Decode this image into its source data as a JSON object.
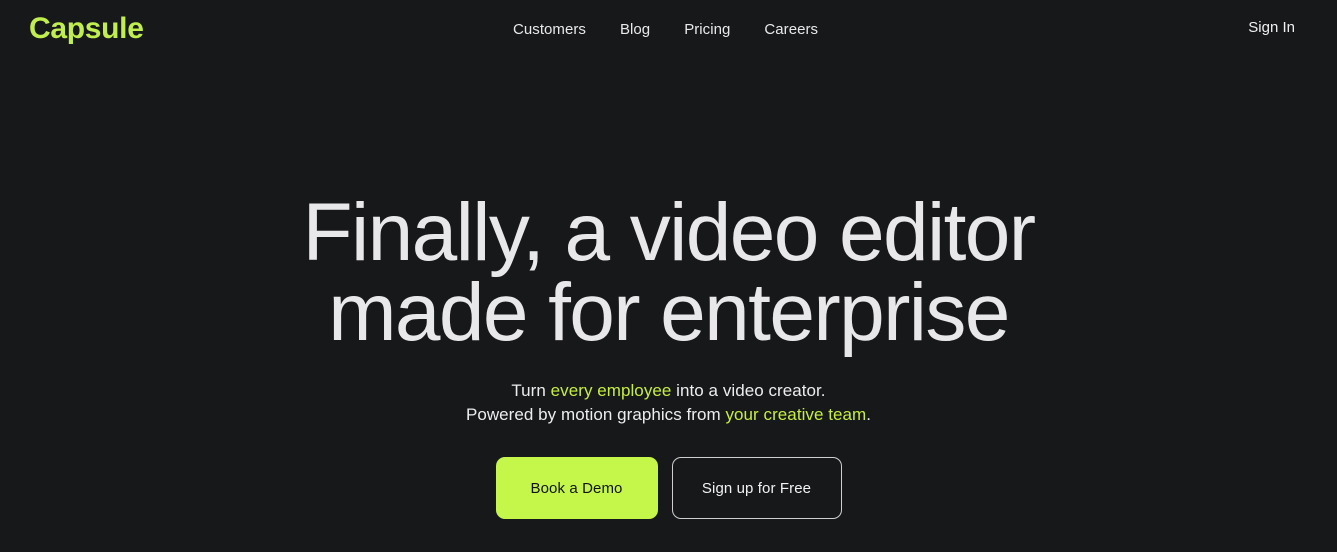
{
  "header": {
    "logo": "Capsule",
    "nav": [
      {
        "label": "Customers"
      },
      {
        "label": "Blog"
      },
      {
        "label": "Pricing"
      },
      {
        "label": "Careers"
      }
    ],
    "sign_in": "Sign In"
  },
  "hero": {
    "title_line1": "Finally, a video editor",
    "title_line2": "made for enterprise",
    "subtitle": {
      "line1_pre": "Turn ",
      "line1_accent": "every employee",
      "line1_post": " into a video creator.",
      "line2_pre": "Powered by motion graphics from ",
      "line2_accent": "your creative team",
      "line2_post": "."
    },
    "primary_cta": "Book a Demo",
    "secondary_cta": "Sign up for Free"
  },
  "colors": {
    "background": "#17181a",
    "accent_green": "#c5f74b",
    "logo_green": "#c0ee4e",
    "text_light": "#e8e8ea",
    "button_text_dark": "#121314",
    "outline_border": "#cfcfd1"
  }
}
